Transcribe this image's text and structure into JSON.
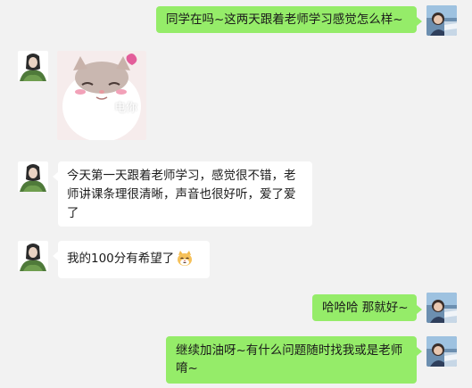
{
  "messages": [
    {
      "side": "out",
      "text": "同学在吗~这两天跟着老师学习感觉怎么样~"
    },
    {
      "side": "in",
      "type": "sticker",
      "sticker_text": "电你"
    },
    {
      "side": "in",
      "text": "今天第一天跟着老师学习，感觉很不错，老师讲课条理很清晰，声音也很好听，爱了爱了"
    },
    {
      "side": "in",
      "text": "我的100分有希望了",
      "emoji": "cat-face-emoji"
    },
    {
      "side": "out",
      "text": "哈哈哈 那就好~"
    },
    {
      "side": "out",
      "text": "继续加油呀~有什么问题随时找我或是老师唷~"
    }
  ],
  "colors": {
    "background": "#f2f2f2",
    "outgoing_bubble": "#95ec69",
    "incoming_bubble": "#ffffff"
  }
}
